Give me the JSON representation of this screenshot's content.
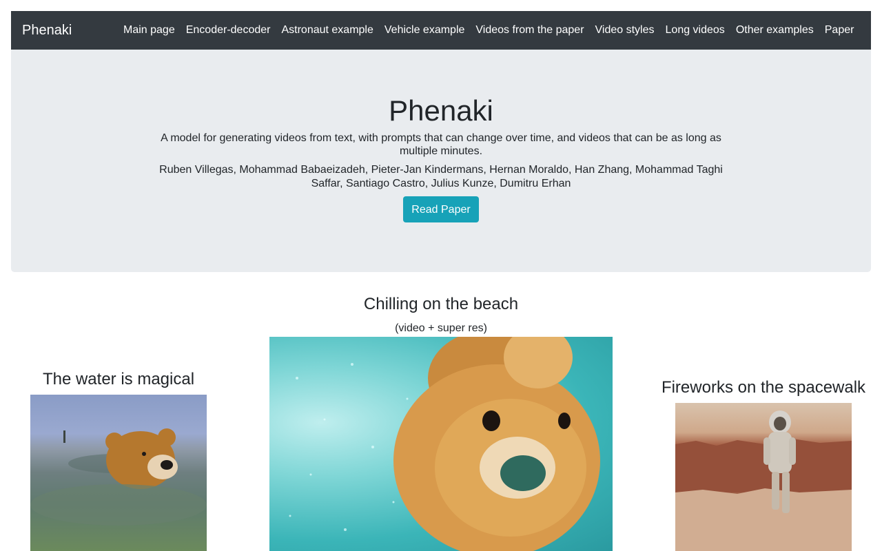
{
  "nav": {
    "brand": "Phenaki",
    "items": [
      {
        "label": "Main page"
      },
      {
        "label": "Encoder-decoder"
      },
      {
        "label": "Astronaut example"
      },
      {
        "label": "Vehicle example"
      },
      {
        "label": "Videos from the paper"
      },
      {
        "label": "Video styles"
      },
      {
        "label": "Long videos"
      },
      {
        "label": "Other examples"
      },
      {
        "label": "Paper"
      }
    ]
  },
  "hero": {
    "title": "Phenaki",
    "description": "A model for generating videos from text, with prompts that can change over time, and videos that can be as long as multiple minutes.",
    "authors": "Ruben Villegas, Mohammad Babaeizadeh, Pieter-Jan Kindermans, Hernan Moraldo, Han Zhang, Mohammad Taghi Saffar, Santiago Castro, Julius Kunze, Dumitru Erhan",
    "button_label": "Read Paper",
    "button_color": "#17a2b8"
  },
  "videos": {
    "left": {
      "title": "The water is magical"
    },
    "center": {
      "title": "Chilling on the beach",
      "subtitle": "(video + super res)"
    },
    "right": {
      "title": "Fireworks on the spacewalk"
    }
  },
  "colors": {
    "navbar": "#343a40",
    "jumbotron": "#e9ecef",
    "text": "#212529"
  }
}
